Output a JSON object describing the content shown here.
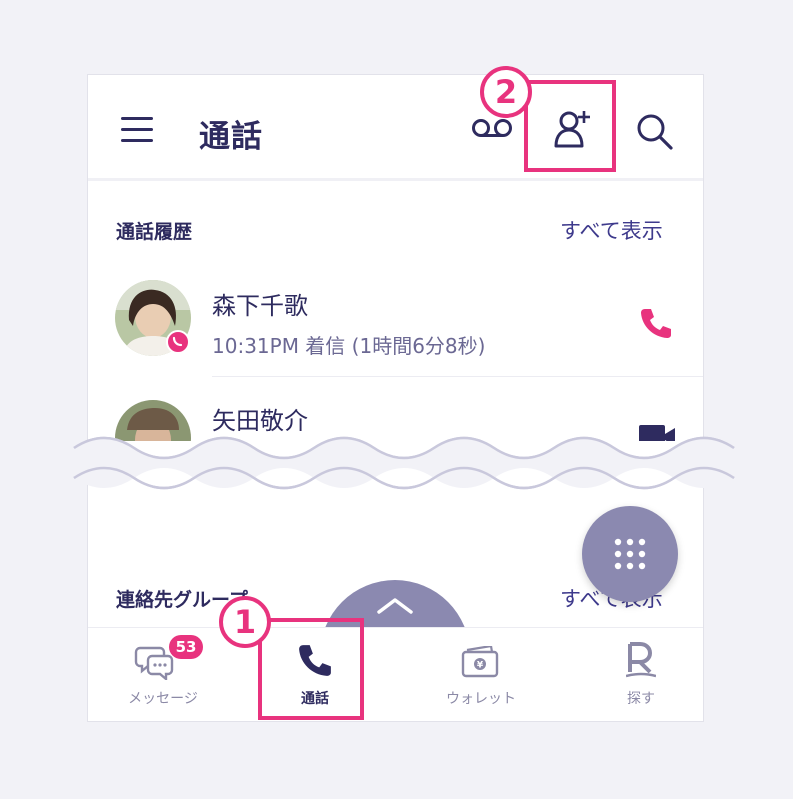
{
  "header": {
    "title": "通話",
    "menu_icon": "hamburger-menu-icon",
    "voicemail_icon": "voicemail-icon",
    "add_contact_icon": "add-contact-icon",
    "search_icon": "search-icon"
  },
  "call_history": {
    "section_title": "通話履歴",
    "see_all_label": "すべて表示",
    "entries": [
      {
        "name": "森下千歌",
        "detail": "10:31PM 着信 (1時間6分8秒)",
        "call_type_icon": "phone-icon"
      },
      {
        "name": "矢田敬介",
        "call_type_icon": "video-icon"
      }
    ]
  },
  "contact_groups": {
    "section_title": "連絡先グループ",
    "see_all_label": "すべて表示"
  },
  "bottom_nav": {
    "items": [
      {
        "label": "メッセージ",
        "icon": "chat-bubbles-icon",
        "badge": "53"
      },
      {
        "label": "通話",
        "icon": "phone-icon",
        "active": true
      },
      {
        "label": "ウォレット",
        "icon": "wallet-icon"
      },
      {
        "label": "探す",
        "icon": "rakuten-r-icon"
      }
    ]
  },
  "annotations": {
    "marker_1": "1",
    "marker_2": "2"
  },
  "colors": {
    "accent": "#e8337e",
    "primary_text": "#2e2b5f",
    "link": "#3e3a8c",
    "fab": "#8b89b0",
    "background": "#f2f2f7"
  }
}
